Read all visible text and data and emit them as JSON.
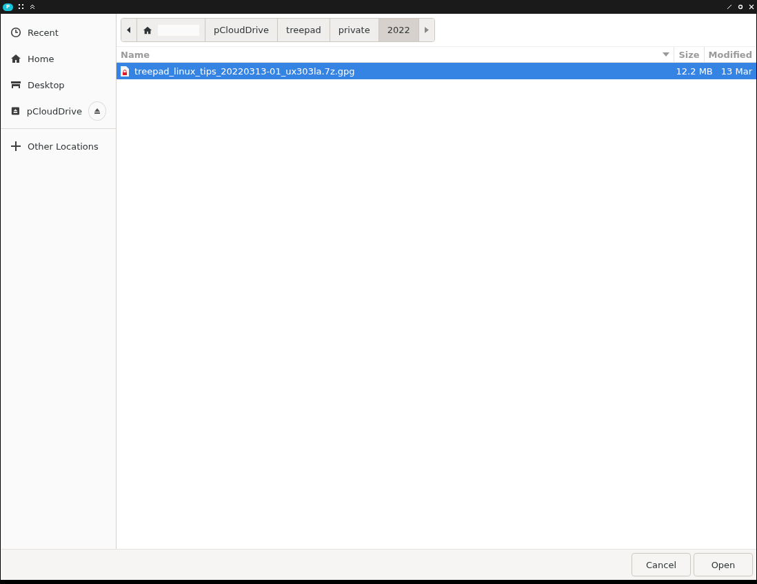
{
  "titlebar": {
    "app_letter": "P"
  },
  "sidebar": {
    "items": [
      {
        "label": "Recent",
        "kind": "clock",
        "eject": false
      },
      {
        "label": "Home",
        "kind": "home",
        "eject": false
      },
      {
        "label": "Desktop",
        "kind": "desktop",
        "eject": false
      },
      {
        "label": "pCloudDrive",
        "kind": "drive",
        "eject": true
      }
    ],
    "other": {
      "label": "Other Locations"
    }
  },
  "pathbar": {
    "crumbs": [
      {
        "kind": "home",
        "selected": false
      },
      {
        "kind": "text",
        "label": "pCloudDrive",
        "selected": false
      },
      {
        "kind": "text",
        "label": "treepad",
        "selected": false
      },
      {
        "kind": "text",
        "label": "private",
        "selected": false
      },
      {
        "kind": "text",
        "label": "2022",
        "selected": true
      }
    ]
  },
  "table": {
    "columns": [
      {
        "label": "Name",
        "sorted": true
      },
      {
        "label": "Size",
        "sorted": false
      },
      {
        "label": "Modified",
        "sorted": false
      }
    ],
    "rows": [
      {
        "name": "treepad_linux_tips_20220313-01_ux303la.7z.gpg",
        "size": "12.2 MB",
        "modified": "13 Mar",
        "selected": true,
        "locked": true
      }
    ]
  },
  "buttons": [
    {
      "label": "Cancel"
    },
    {
      "label": "Open"
    }
  ]
}
